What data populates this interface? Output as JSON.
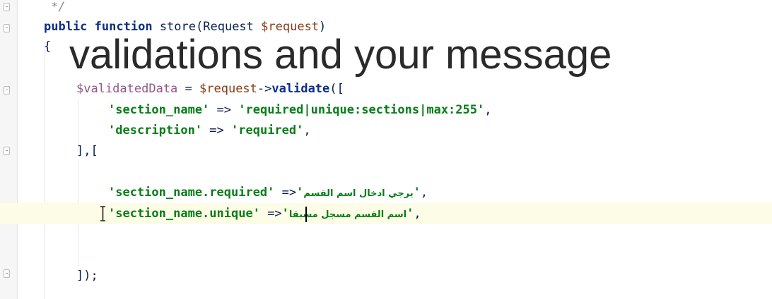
{
  "editor": {
    "comment_end": "*/",
    "line_signature": {
      "keyword_public": "public",
      "keyword_function": "function",
      "name": "store",
      "open_paren": "(",
      "param_type": "Request",
      "param_var": "$request",
      "close_paren": ")"
    },
    "brace_open": "{",
    "line_validate": {
      "var": "$validatedData",
      "assign": " = ",
      "request_var": "$request",
      "arrow": "->",
      "method": "validate",
      "open": "(["
    },
    "rule_section": {
      "key": "'section_name'",
      "arrow": " => ",
      "value": "'required|unique:sections|max:255'",
      "comma": ","
    },
    "rule_description": {
      "key": "'description'",
      "arrow": " => ",
      "value": "'required'",
      "comma": ","
    },
    "array_close_open": "],[",
    "msg_required": {
      "key": "'section_name.required'",
      "arrow": " =>",
      "quote_open": "'",
      "arabic": "يرجي ادخال اسم القسم",
      "quote_close": "'",
      "comma": ","
    },
    "msg_unique": {
      "key": "'section_name.unique'",
      "arrow": " =>",
      "quote_open": "'",
      "arabic": "اسم القسم مسجل مسبقا",
      "quote_close": "'",
      "comma": ","
    },
    "array_end": "]);"
  },
  "overlay_caption": "validations and your message",
  "colors": {
    "keyword": "#0b2d89",
    "variable": "#8a3a14",
    "string": "#067d17",
    "comment": "#8c8c8c",
    "caret_line_bg": "#fdfce6"
  }
}
